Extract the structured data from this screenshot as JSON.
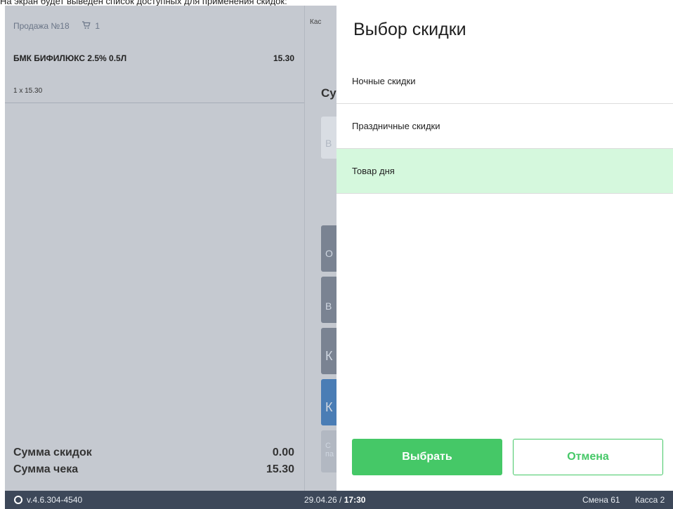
{
  "caption": "На экран будет выведен список доступных для применения скидок:",
  "receipt": {
    "sale_label": "Продажа №18",
    "cart_count": "1",
    "item": {
      "name": "БМК БИФИЛЮКС 2.5% 0.5Л",
      "sum": "15.30",
      "qty_price": "1 x 15.30"
    },
    "discount_label": "Сумма скидок",
    "discount_value": "0.00",
    "total_label": "Сумма чека",
    "total_value": "15.30"
  },
  "middle": {
    "kas_label": "Кас",
    "title_fragment": "Су",
    "btn1": "В",
    "btn2": "О",
    "btn3": "В",
    "btn4": "К",
    "btn5": "К",
    "btn6": "С\nпа"
  },
  "modal": {
    "title": "Выбор скидки",
    "options": [
      {
        "label": "Ночные скидки",
        "selected": false
      },
      {
        "label": "Праздничные скидки",
        "selected": false
      },
      {
        "label": "Товар дня",
        "selected": true
      }
    ],
    "select_button": "Выбрать",
    "cancel_button": "Отмена"
  },
  "statusbar": {
    "version": "v.4.6.304-4540",
    "date": "29.04.26 / ",
    "time": "17:30",
    "shift": "Смена 61",
    "register": "Касса 2"
  },
  "colors": {
    "accent_green": "#45c867",
    "selected_bg": "#d5f8dd",
    "panel_gray": "#c5c9d0",
    "statusbar_bg": "#3d4859",
    "blue_button": "#4a7db5"
  }
}
